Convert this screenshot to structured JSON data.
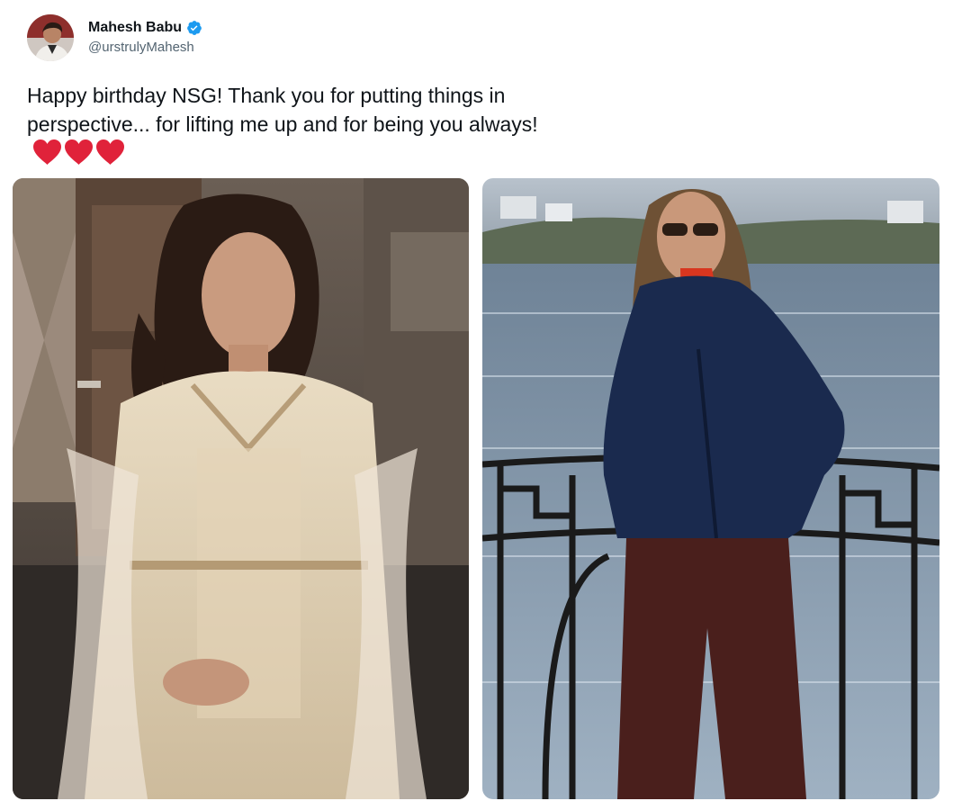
{
  "tweet": {
    "author": {
      "display_name": "Mahesh Babu",
      "handle": "@urstrulyMahesh",
      "verified": true,
      "avatar_icon": "profile-photo",
      "verified_icon": "verified-badge-icon",
      "verified_color": "#1d9bf0"
    },
    "text": "Happy birthday NSG! Thank you for putting things in perspective... for lifting me up and for being you always!",
    "emoji": [
      "red-heart-icon",
      "red-heart-icon",
      "red-heart-icon"
    ],
    "heart_color": "#e0223a",
    "media": [
      {
        "type": "photo",
        "name": "photo-woman-in-ethnic-dress"
      },
      {
        "type": "photo",
        "name": "photo-woman-by-lake"
      }
    ]
  }
}
